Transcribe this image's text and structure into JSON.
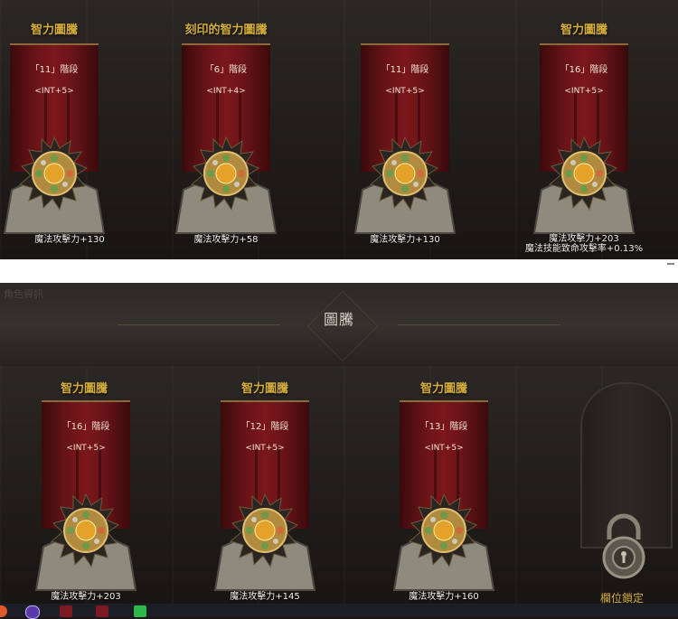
{
  "top_row": [
    {
      "title": "智力圖騰",
      "stage": "「11」階段",
      "stat": "<INT+5>",
      "effects": [
        "魔法攻擊力+130"
      ]
    },
    {
      "title": "刻印的智力圖騰",
      "stage": "「6」階段",
      "stat": "<INT+4>",
      "effects": [
        "魔法攻擊力+58"
      ]
    },
    {
      "title": "",
      "stage": "「11」階段",
      "stat": "<INT+5>",
      "effects": [
        "魔法攻擊力+130"
      ]
    },
    {
      "title": "智力圖騰",
      "stage": "「16」階段",
      "stat": "<INT+5>",
      "effects": [
        "魔法攻擊力+203",
        "魔法技能致命攻擊率+0.13%"
      ]
    }
  ],
  "section": {
    "title": "圖騰",
    "ghost_label": "角色資訊"
  },
  "bottom_row": [
    {
      "title": "智力圖騰",
      "stage": "「16」階段",
      "stat": "<INT+5>",
      "effects": [
        "魔法攻擊力+203"
      ]
    },
    {
      "title": "智力圖騰",
      "stage": "「12」階段",
      "stat": "<INT+5>",
      "effects": [
        "魔法攻擊力+145"
      ]
    },
    {
      "title": "智力圖騰",
      "stage": "「13」階段",
      "stat": "<INT+5>",
      "effects": [
        "魔法攻擊力+160"
      ]
    }
  ],
  "locked_slot": {
    "label": "欄位鎖定"
  },
  "colors": {
    "title_gold": "#d4ad3c",
    "banner_red": "#7a171b",
    "text_light": "#f1e4d0"
  },
  "taskbar_icons": [
    "browser-icon",
    "app-icon",
    "game-icon",
    "game-icon-2",
    "line-icon"
  ]
}
